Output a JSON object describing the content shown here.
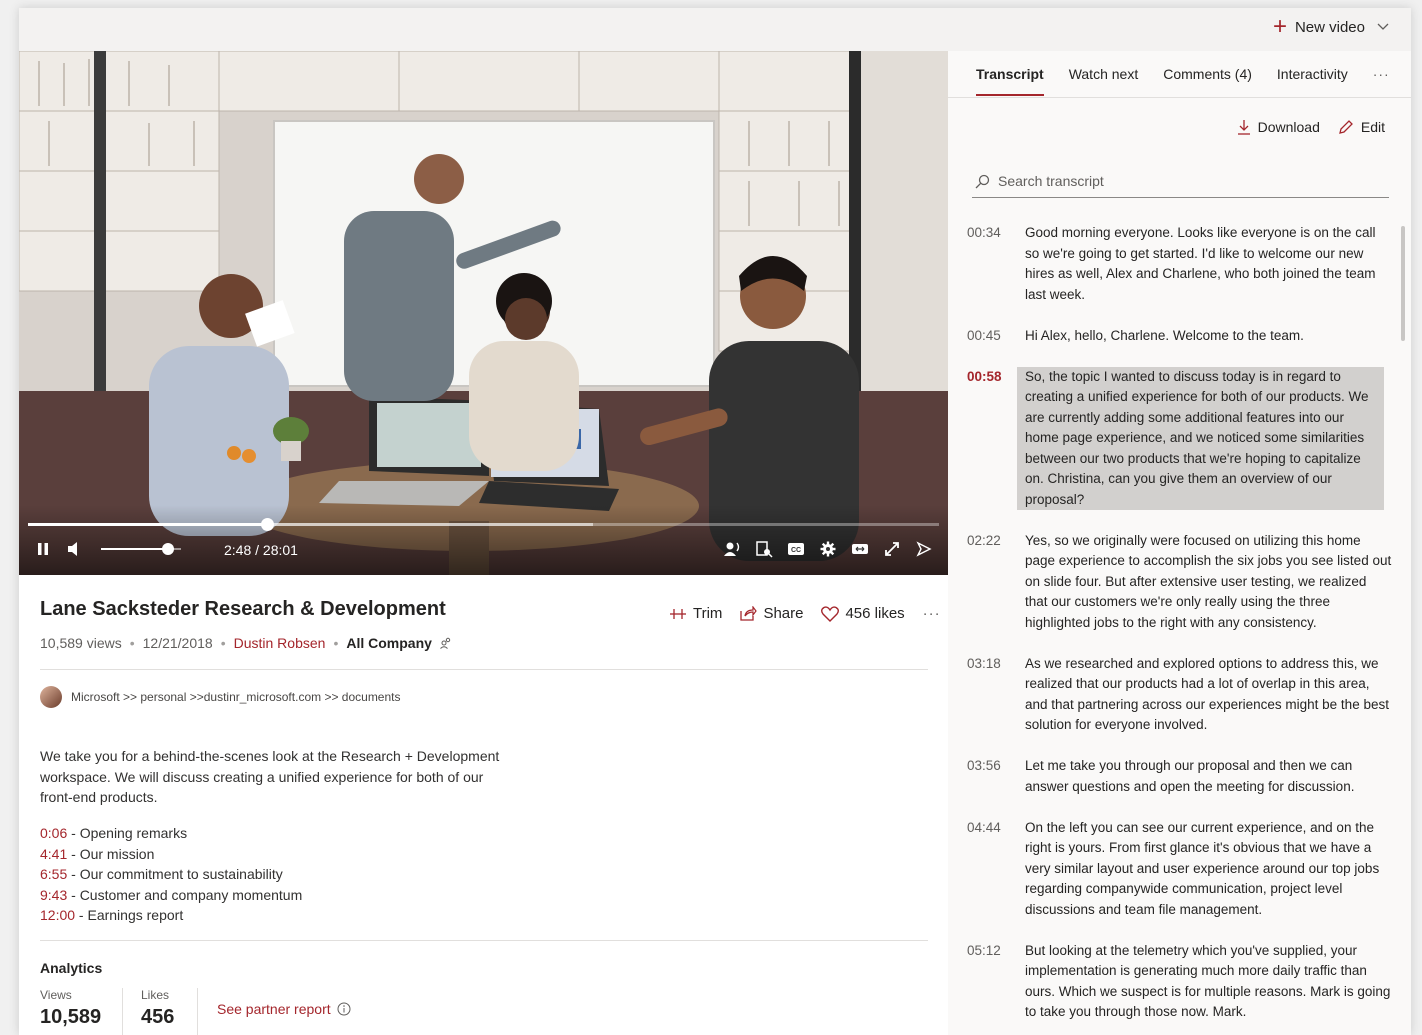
{
  "topbar": {
    "new_video": "New video"
  },
  "player": {
    "time": "2:48 / 28:01",
    "progress": 0.262,
    "buffered": 0.62,
    "volume": 0.84
  },
  "video": {
    "title": "Lane Sacksteder Research & Development",
    "views": "10,589 views",
    "date": "12/21/2018",
    "author": "Dustin Robsen",
    "audience": "All Company",
    "actions": {
      "trim": "Trim",
      "share": "Share",
      "likes": "456 likes",
      "more": "···"
    },
    "breadcrumb": "Microsoft >> personal >>dustinr_microsoft.com >> documents",
    "description": "We take you for a behind-the-scenes look at the Research + Development workspace. We will discuss creating a unified experience for both of our front-end products.",
    "chapters": [
      {
        "ts": "0:06",
        "label": " - Opening remarks"
      },
      {
        "ts": "4:41",
        "label": " - Our mission"
      },
      {
        "ts": "6:55",
        "label": " - Our commitment to sustainability"
      },
      {
        "ts": "9:43",
        "label": " - Customer and company momentum"
      },
      {
        "ts": "12:00",
        "label": " - Earnings report"
      }
    ]
  },
  "analytics": {
    "heading": "Analytics",
    "views_label": "Views",
    "views_value": "10,589",
    "likes_label": "Likes",
    "likes_value": "456",
    "partner_link": "See partner report"
  },
  "panel": {
    "tabs": [
      "Transcript",
      "Watch next",
      "Comments (4)",
      "Interactivity"
    ],
    "more": "···",
    "download": "Download",
    "edit": "Edit",
    "search_placeholder": "Search transcript",
    "entries": [
      {
        "t": "00:34",
        "text": "Good morning everyone. Looks like everyone is on the call so we're going to get started. I'd like to welcome our new hires as well, Alex and Charlene, who both joined the team last week."
      },
      {
        "t": "00:45",
        "text": "Hi Alex, hello, Charlene. Welcome to the team."
      },
      {
        "t": "00:58",
        "text": "So, the topic I wanted to discuss today is in regard to creating a unified experience for both of our products. We are currently adding some additional features into our home page experience, and we noticed some similarities between our two products that we're hoping to capitalize on. Christina, can you give them an overview of our proposal?",
        "current": true
      },
      {
        "t": "02:22",
        "text": "Yes, so we originally were focused on utilizing this home page experience to accomplish the six jobs you see listed out on slide four. But after extensive user testing, we realized that our customers we're only really using the three highlighted jobs to the right with any consistency."
      },
      {
        "t": "03:18",
        "text": "As we researched and explored options to address this, we realized that our products had a lot of overlap in this area, and that partnering across our experiences might be the best solution for everyone involved."
      },
      {
        "t": "03:56",
        "text": "Let me take you through our proposal and then we can answer questions and open the meeting for discussion."
      },
      {
        "t": "04:44",
        "text": "On the left you can see our current experience, and on the right is yours. From first glance it's obvious that we have a very similar layout and user experience around our top jobs regarding companywide communication, project level discussions and team file management."
      },
      {
        "t": "05:12",
        "text": "But looking at the telemetry which you've supplied, your implementation is generating much more daily traffic than ours. Which we suspect is for multiple reasons. Mark is going to take you through those now. Mark."
      }
    ]
  }
}
